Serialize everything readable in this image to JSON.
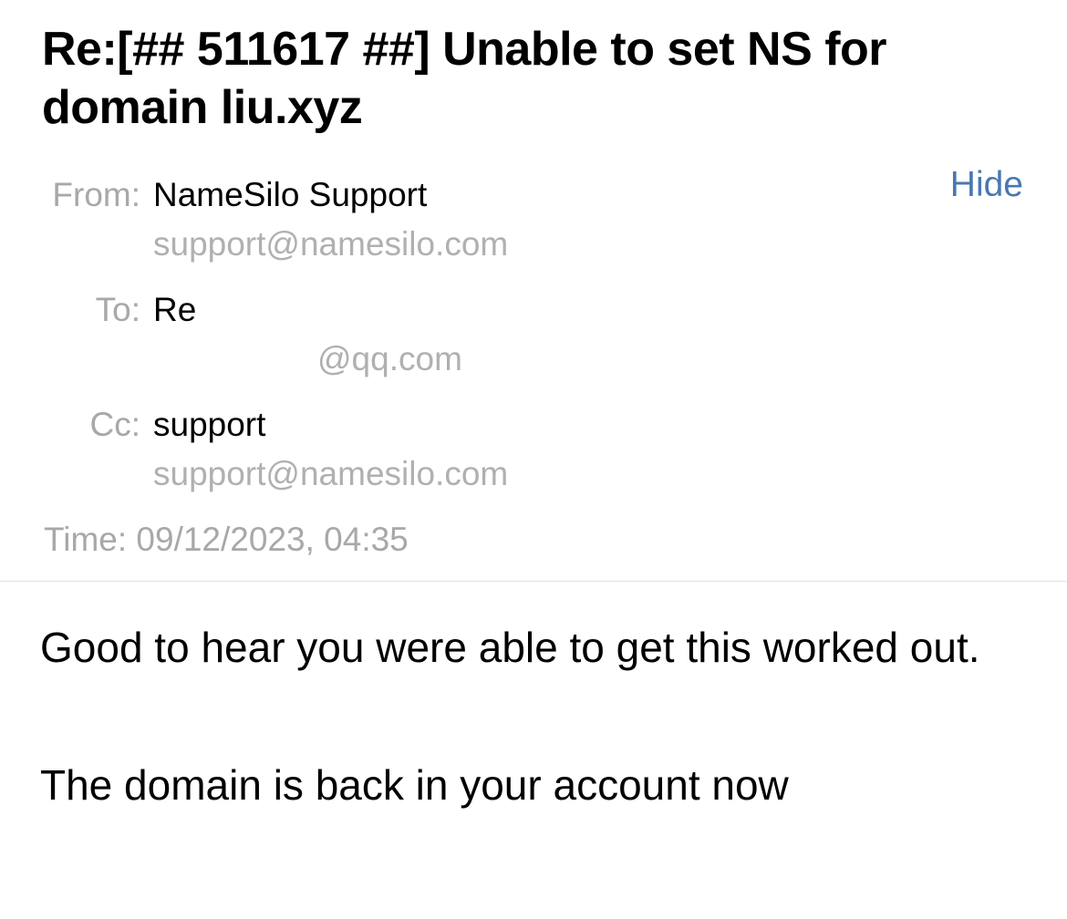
{
  "email": {
    "subject": "Re:[## 511617 ##] Unable to set NS for domain liu.xyz",
    "hide_label": "Hide",
    "from": {
      "label": "From:",
      "name": "NameSilo Support",
      "address": "support@namesilo.com"
    },
    "to": {
      "label": "To:",
      "name": "Re",
      "address_visible": "@qq.com"
    },
    "cc": {
      "label": "Cc:",
      "name": "support",
      "address": "support@namesilo.com"
    },
    "time": {
      "label": "Time:",
      "value": "09/12/2023, 04:35"
    },
    "body": {
      "paragraphs": [
        "Good to hear you were able to get this worked out.",
        "The domain is back in your account now"
      ]
    }
  },
  "colors": {
    "accent": "#4a78b0",
    "label": "#a8a8a8",
    "secondary": "#b0b0b0",
    "divider": "#e2e2e2"
  }
}
